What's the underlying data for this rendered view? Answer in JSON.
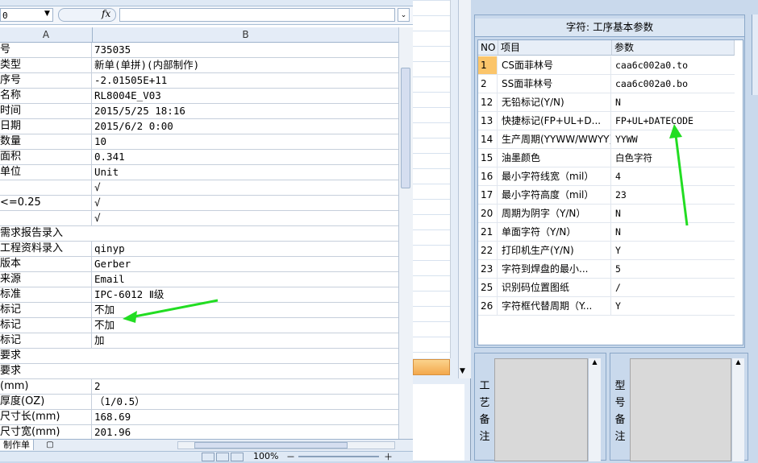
{
  "spreadsheet": {
    "name_box": "0",
    "fx_label": "fx",
    "columns": [
      "A",
      "B"
    ],
    "rows": [
      {
        "a": "号",
        "b": "735035"
      },
      {
        "a": "类型",
        "b": "新单(单拼)(内部制作)"
      },
      {
        "a": "序号",
        "b": "-2.01505E+11"
      },
      {
        "a": "名称",
        "b": "RL8004E_V03"
      },
      {
        "a": "时间",
        "b": "2015/5/25 18:16"
      },
      {
        "a": "日期",
        "b": "2015/6/2 0:00"
      },
      {
        "a": "数量",
        "b": "10"
      },
      {
        "a": "面积",
        "b": "0.341"
      },
      {
        "a": "单位",
        "b": "Unit"
      },
      {
        "a": "",
        "b": "√"
      },
      {
        "a": "<=0.25",
        "b": "√"
      },
      {
        "a": "",
        "b": "√"
      },
      {
        "a": "需求报告录入",
        "b": "",
        "merged": true
      },
      {
        "a": "工程资料录入",
        "b": "qinyp"
      },
      {
        "a": "版本",
        "b": "Gerber"
      },
      {
        "a": "来源",
        "b": "Email"
      },
      {
        "a": "标准",
        "b": "IPC-6012 Ⅱ级"
      },
      {
        "a": "标记",
        "b": "不加"
      },
      {
        "a": "标记",
        "b": "不加"
      },
      {
        "a": "标记",
        "b": "加"
      },
      {
        "a": "要求",
        "b": "",
        "merged": true
      },
      {
        "a": "要求",
        "b": "",
        "merged": true
      },
      {
        "a": "(mm)",
        "b": "2"
      },
      {
        "a": "厚度(OZ)",
        "b": "（1/0.5）"
      },
      {
        "a": "尺寸长(mm)",
        "b": "168.69"
      },
      {
        "a": "尺寸宽(mm)",
        "b": "201.96"
      }
    ],
    "sheet_tab": "制作单",
    "zoom": "100%",
    "zoom_minus": "－",
    "zoom_plus": "＋"
  },
  "param_panel": {
    "title": "字符: 工序基本参数",
    "headers": {
      "no": "NO",
      "item": "项目",
      "value": "参数"
    },
    "rows": [
      {
        "no": "1",
        "item": "CS面菲林号",
        "value": "caa6c002a0.to"
      },
      {
        "no": "2",
        "item": "SS面菲林号",
        "value": "caa6c002a0.bo"
      },
      {
        "no": "12",
        "item": "无铅标记(Y/N)",
        "value": "N"
      },
      {
        "no": "13",
        "item": "快捷标记(FP+UL+D...",
        "value": "FP+UL+DATECODE"
      },
      {
        "no": "14",
        "item": "生产周期(YYWW/WWYY)",
        "value": "YYWW"
      },
      {
        "no": "15",
        "item": "油墨颜色",
        "value": "白色字符"
      },
      {
        "no": "16",
        "item": "最小字符线宽（mil）",
        "value": "4"
      },
      {
        "no": "17",
        "item": "最小字符高度（mil）",
        "value": "23"
      },
      {
        "no": "20",
        "item": "周期为阴字（Y/N）",
        "value": "N"
      },
      {
        "no": "21",
        "item": "单面字符（Y/N）",
        "value": "N"
      },
      {
        "no": "22",
        "item": "打印机生产(Y/N)",
        "value": "Y"
      },
      {
        "no": "23",
        "item": "字符到焊盘的最小...",
        "value": "5"
      },
      {
        "no": "25",
        "item": "识别码位置图纸",
        "value": "/"
      },
      {
        "no": "26",
        "item": "字符框代替周期（Y...",
        "value": "Y"
      }
    ]
  },
  "remarks": {
    "process_label": "工\n艺\n备\n注",
    "model_label": "型\n号\n备\n注"
  },
  "colors": {
    "selection": "#fbc56a",
    "arrow": "#22dd22",
    "panel_bg": "#c9d9ec"
  }
}
